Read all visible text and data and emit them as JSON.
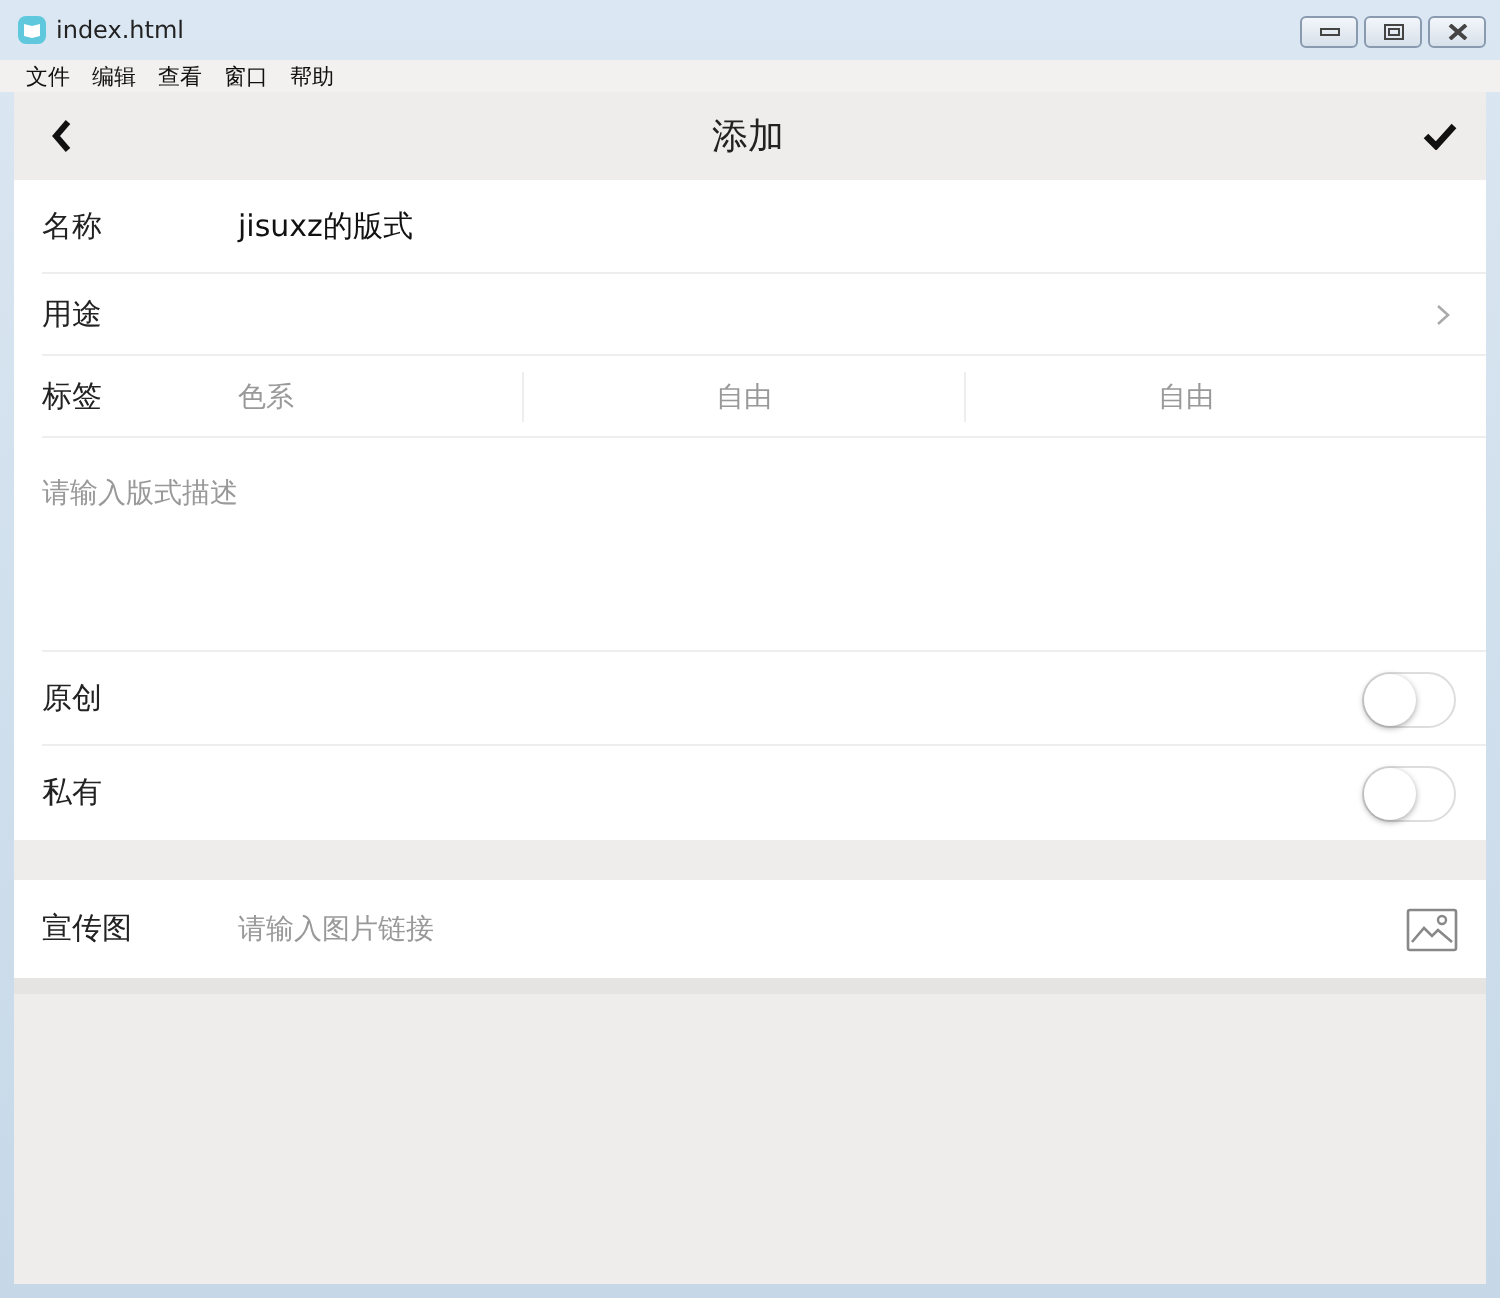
{
  "window": {
    "title": "index.html"
  },
  "menu": [
    "文件",
    "编辑",
    "查看",
    "窗口",
    "帮助"
  ],
  "nav": {
    "title": "添加"
  },
  "name_row": {
    "label": "名称",
    "value": "jisuxz的版式"
  },
  "purpose_row": {
    "label": "用途"
  },
  "tags_row": {
    "label": "标签",
    "fields": [
      {
        "placeholder": "色系"
      },
      {
        "placeholder": "自由"
      },
      {
        "placeholder": "自由"
      }
    ]
  },
  "description": {
    "placeholder": "请输入版式描述"
  },
  "switches": [
    {
      "label": "原创",
      "on": false
    },
    {
      "label": "私有",
      "on": false
    }
  ],
  "promo_row": {
    "label": "宣传图",
    "placeholder": "请输入图片链接"
  }
}
